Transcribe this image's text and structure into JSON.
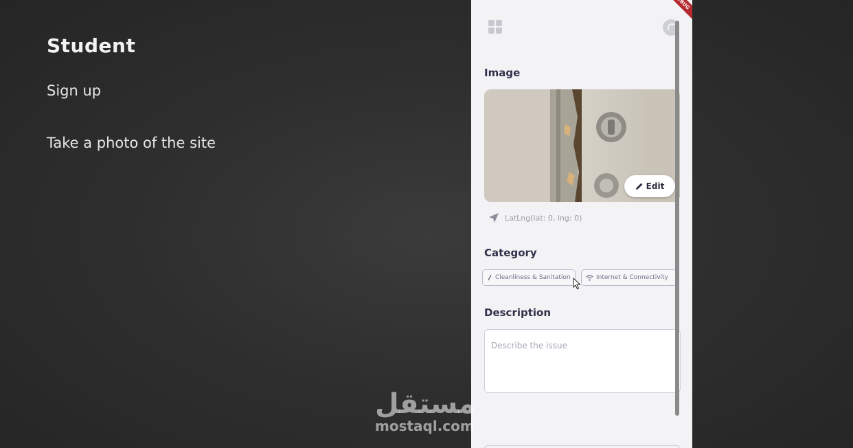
{
  "slide": {
    "title": "Student",
    "steps": [
      "Sign up",
      "Take a photo of the site"
    ]
  },
  "app": {
    "debug_banner": "DEBUG",
    "image_section": {
      "label": "Image",
      "edit_label": "Edit",
      "location_text": "LatLng(lat: 0, lng: 0)"
    },
    "category_section": {
      "label": "Category",
      "chips": [
        "Cleanliness & Sanitation",
        "Internet & Connectivity"
      ]
    },
    "description_section": {
      "label": "Description",
      "placeholder": "Describe the issue"
    },
    "colors": {
      "accent": "#30324a",
      "chip_border": "#b9bccf",
      "debug_banner": "#b52a2f"
    }
  },
  "watermark": {
    "arabic": "مستقل",
    "latin": "mostaql.com"
  },
  "icons": [
    "grid-icon",
    "profile-icon",
    "pencil-icon",
    "location-arrow-icon",
    "sparkle-icon",
    "wifi-icon",
    "cursor-icon"
  ]
}
